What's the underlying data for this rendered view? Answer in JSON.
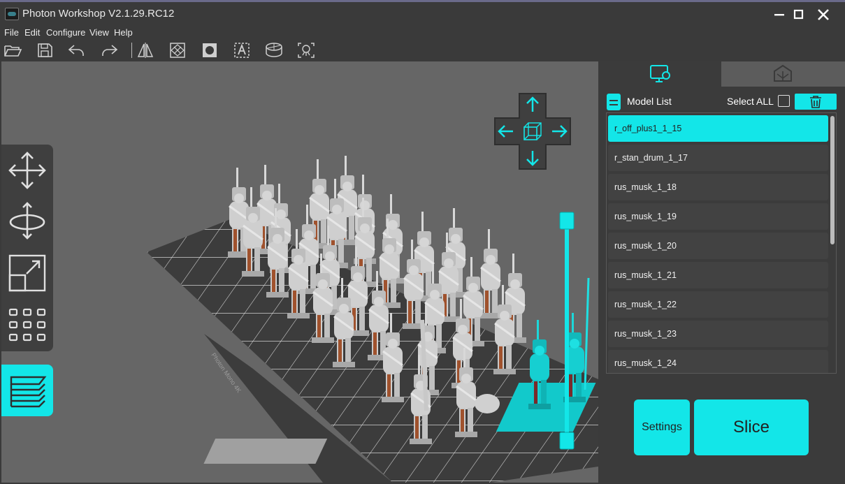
{
  "window": {
    "title": "Photon Workshop V2.1.29.RC12",
    "minimize": "—",
    "maximize": "□",
    "close": "✕"
  },
  "menu": [
    "File",
    "Edit",
    "Configure",
    "View",
    "Help"
  ],
  "toolbar": {
    "icons": [
      "open-folder-icon",
      "save-icon",
      "undo-icon",
      "redo-icon",
      "mirror-icon",
      "hollow-icon",
      "punch-hole-icon",
      "text-icon",
      "cylinder-icon",
      "auto-support-icon"
    ]
  },
  "left_tools": {
    "icons": [
      "move-icon",
      "rotate-icon",
      "scale-icon",
      "arrange-grid-icon",
      "layers-icon"
    ]
  },
  "right_panel": {
    "tabs": [
      "settings-monitor-icon",
      "supports-icon"
    ],
    "model_list_title": "Model List",
    "select_all_label": "Select ALL",
    "models": [
      "r_off_plus1_1_15",
      "r_stan_drum_1_17",
      "rus_musk_1_18",
      "rus_musk_1_19",
      "rus_musk_1_20",
      "rus_musk_1_21",
      "rus_musk_1_22",
      "rus_musk_1_23",
      "rus_musk_1_24"
    ],
    "selected_index": 0,
    "settings_label": "Settings",
    "slice_label": "Slice"
  },
  "viewport": {
    "build_plate_label": "Photon Mono 4K"
  },
  "colors": {
    "accent": "#13e6e8",
    "background": "#3a3a3a",
    "viewport": "#666666",
    "model": "#cfcfcf",
    "base": "#a8a8a8",
    "musket": "#a0522d"
  }
}
